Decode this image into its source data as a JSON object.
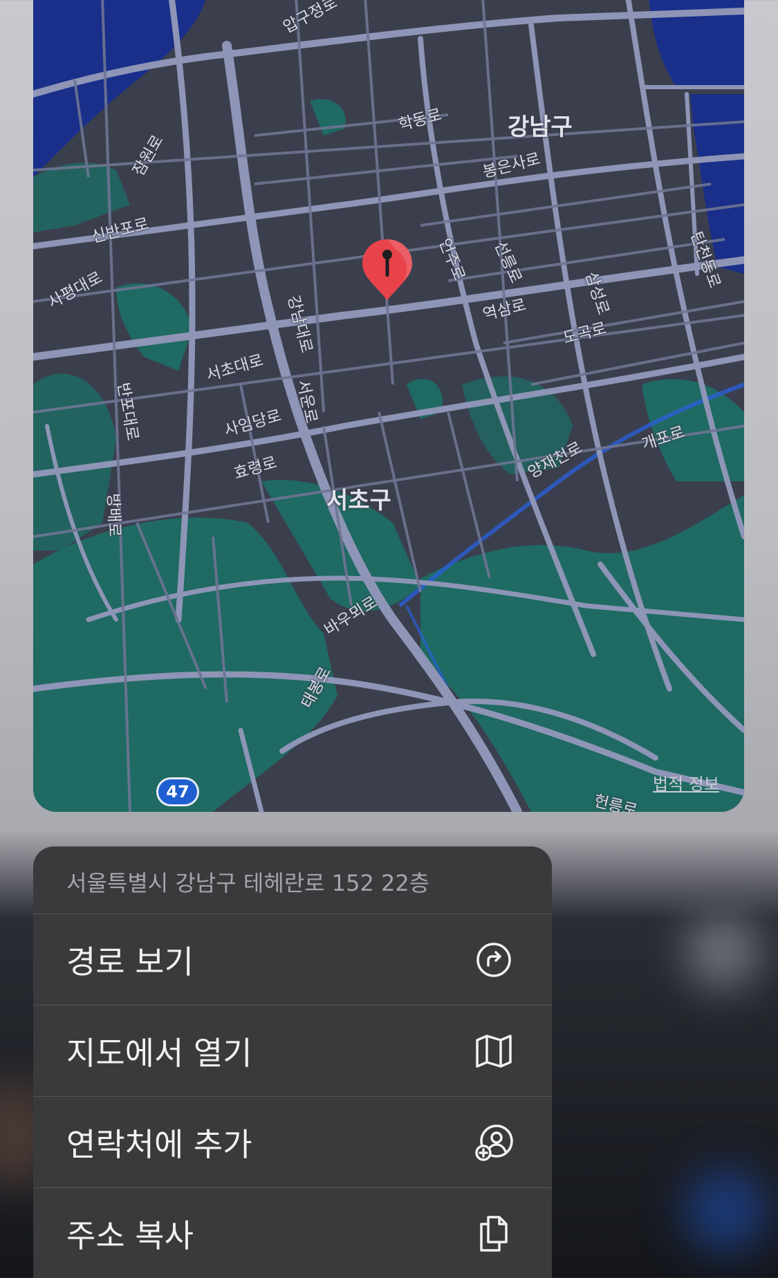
{
  "map": {
    "legal_info": "법적 정보",
    "route_number": "47",
    "districts": [
      "강남구",
      "서초구"
    ],
    "roads": [
      "압구정로",
      "학동로",
      "봉은사로",
      "잠원로",
      "탄천동로",
      "신반포로",
      "언주로",
      "선릉로",
      "삼성로",
      "사평대로",
      "강남대로",
      "역삼로",
      "도곡로",
      "반포대로",
      "서초대로",
      "서운로",
      "사임당로",
      "양재천로",
      "개포로",
      "방배로",
      "효령로",
      "바우뫼로",
      "태봉로",
      "헌릉로"
    ]
  },
  "menu": {
    "address": "서울특별시 강남구 테헤란로 152 22층",
    "items": [
      {
        "label": "경로 보기",
        "icon": "directions-icon"
      },
      {
        "label": "지도에서 열기",
        "icon": "map-icon"
      },
      {
        "label": "연락처에 추가",
        "icon": "add-contact-icon"
      },
      {
        "label": "주소 복사",
        "icon": "copy-icon"
      }
    ]
  },
  "colors": {
    "map_base": "#3b3f4d",
    "road": "#8e95b6",
    "water": "#1a2f8a",
    "park": "#1f6a63",
    "pin": "#e8434b",
    "menu_bg": "#3a3a3c"
  }
}
